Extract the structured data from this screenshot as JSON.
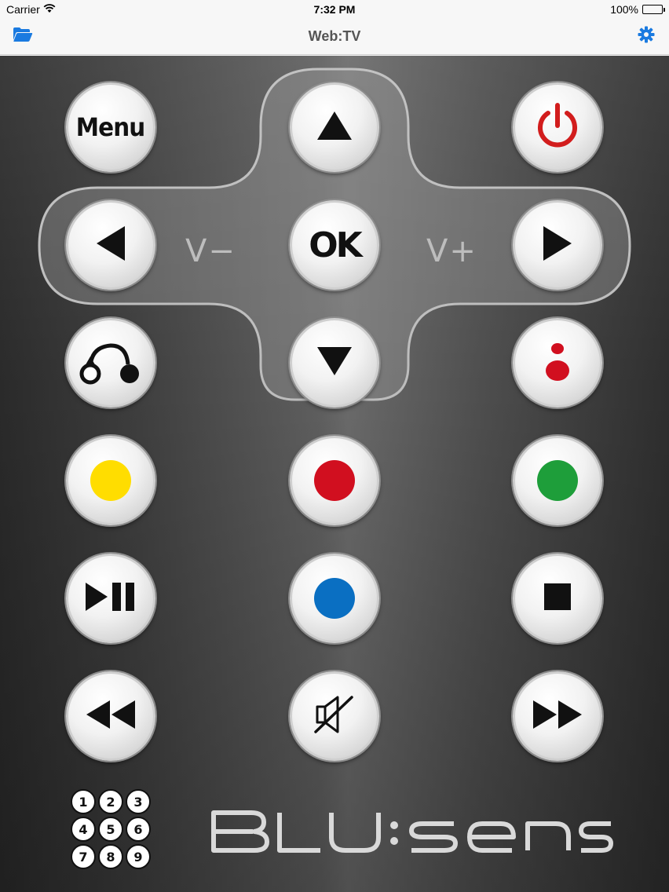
{
  "status_bar": {
    "carrier": "Carrier",
    "time": "7:32 PM",
    "battery": "100%",
    "battery_level": 1.0
  },
  "nav": {
    "title": "Web:TV",
    "left_icon": "folder-open-icon",
    "right_icon": "gear-icon"
  },
  "accent_color": "#1a7ae0",
  "remote": {
    "menu_label": "Menu",
    "ok_label": "OK",
    "vol_minus_label": "V−",
    "vol_plus_label": "V+",
    "power_color": "#d21d1d",
    "color_buttons": {
      "yellow": "#ffdd00",
      "red": "#d10f1f",
      "green": "#1e9e3a",
      "blue": "#0a6fc2"
    },
    "numpad_keys": [
      "1",
      "2",
      "3",
      "4",
      "5",
      "6",
      "7",
      "8",
      "9"
    ],
    "brand": "BLU:sens"
  }
}
